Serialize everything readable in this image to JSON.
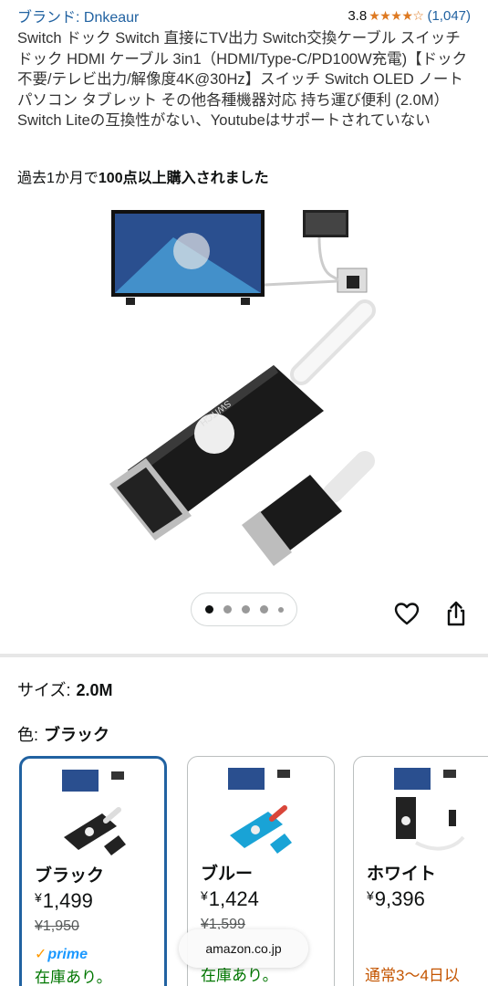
{
  "brand": "ブランド: Dnkeaur",
  "rating": {
    "value": "3.8",
    "stars": "★★★★☆",
    "count": "(1,047)"
  },
  "title": "Switch ドック Switch 直接にTV出力 Switch交換ケーブル スイッチ ドック HDMI ケーブル 3in1（HDMI/Type-C/PD100W充電)【ドック不要/テレビ出力/解像度4K@30Hz】スイッチ Switch OLED ノートパソコン タブレット その他各種機器対応 持ち運び便利 (2.0M）Switch Liteの互換性がない、Youtubeはサポートされていない",
  "purchased": {
    "prefix": "過去1か月で",
    "bold": "100点以上購入されました"
  },
  "image": {
    "logo_text": "SWITCH"
  },
  "carousel": {
    "total": 5,
    "active": 0
  },
  "size": {
    "label": "サイズ:",
    "value": "2.0M"
  },
  "color": {
    "label": "色:",
    "value": "ブラック"
  },
  "variants": [
    {
      "name": "ブラック",
      "yen": "¥",
      "price": "1,499",
      "was": "¥1,950",
      "prime": "prime",
      "stock": "在庫あり。",
      "cable_color": "#222222"
    },
    {
      "name": "ブルー",
      "yen": "¥",
      "price": "1,424",
      "was": "¥1,599",
      "stock": "在庫あり。",
      "cable_color": "#19a3d6"
    },
    {
      "name": "ホワイト",
      "yen": "¥",
      "price": "9,396",
      "delivery": "通常3〜4日以",
      "cable_color": "#222222"
    }
  ],
  "url_pill": "amazon.co.jp",
  "colors": {
    "link": "#2162a1",
    "star": "#de7921",
    "stock": "#007600",
    "delivery": "#c45500"
  }
}
